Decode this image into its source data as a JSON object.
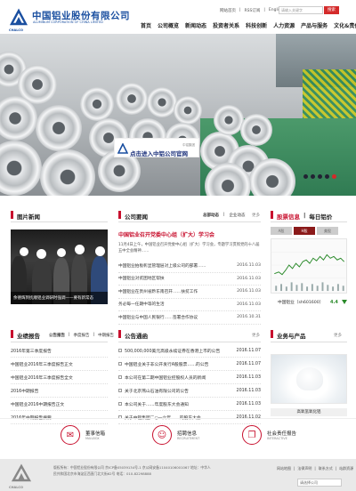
{
  "header": {
    "logo_cn": "中国铝业股份有限公司",
    "logo_en": "ALUMINUM CORPORATION OF CHINA LIMITED",
    "logo_sub": "CHALCO",
    "toplinks": [
      "网站首页",
      "RSS订阅",
      "English"
    ],
    "search_placeholder": "请输入关键字",
    "search_button": "搜索"
  },
  "nav": [
    "首页",
    "公司概览",
    "新闻动态",
    "投资者关系",
    "科技创新",
    "人力资源",
    "产品与服务",
    "文化&责任"
  ],
  "banner": {
    "overlay_text": "点击进入中铝公司官网",
    "overlay_small": "中铝集团"
  },
  "image_news": {
    "title": "图片新闻",
    "caption": "余德辉到抚顺铝业调研时强调——要有新常态"
  },
  "company_news": {
    "title": "公司要闻",
    "tabs": [
      "总部动态",
      "企业动态"
    ],
    "more": "更多",
    "headline": "中国铝业召开党委中心组（扩大）学习会",
    "summary": "11月4日上午，中国铝业召开党委中心组（扩大）学习会，专题学习贯彻党的十八届五中全会精神……",
    "items": [
      {
        "title": "中国铝业拍板彰显管理层对上级公司的部署……",
        "date": "2016.11.03"
      },
      {
        "title": "中国铝业对贫困地区帮扶",
        "date": "2016.11.03"
      },
      {
        "title": "中国铝业在贵州省黔东南召开……扶贫工作",
        "date": "2016.11.03"
      },
      {
        "title": "务必每一任期中等的生活",
        "date": "2016.11.03"
      },
      {
        "title": "中国铝业与中国人民银行……签署合作协议",
        "date": "2016.10.31"
      }
    ]
  },
  "stock": {
    "tab1": "股票信息",
    "tab2": "每日铝价",
    "tabs": [
      "A股",
      "H股",
      "美股"
    ],
    "label": "中国铝业（sh601600）",
    "value": "4.4"
  },
  "reports": {
    "title": "业绩报告",
    "tabs": [
      "公告报告",
      "季度报告",
      "中期报告"
    ],
    "more": "更多",
    "items": [
      "2016年第三季度报告",
      "中国铝业2016年三季度报告正文",
      "中国铝业2016年三季度报告全文",
      "2016中期报告",
      "中国铝业2016中期报告正文",
      "2016年中期报告摘要"
    ]
  },
  "announcements": {
    "title": "公告通函",
    "more": "更多",
    "items": [
      {
        "title": "500,000,000美元高级永续证券在香港上市的公告",
        "date": "2016.11.07"
      },
      {
        "title": "中国铝业关于非公开发行A股股票……的公告",
        "date": "2016.11.07"
      },
      {
        "title": "本公司在第二期中国铝业控股权人员的新闻",
        "date": "2016.11.03"
      },
      {
        "title": "关于北京燕山石油有限公司的公告",
        "date": "2016.11.03"
      },
      {
        "title": "本公司关于……年度股东大会通知",
        "date": "2016.11.03"
      },
      {
        "title": "关于中铝集团二○一六年……的股东大会",
        "date": "2016.11.02"
      }
    ]
  },
  "products": {
    "title": "业务与产品",
    "more": "更多",
    "caption": "高氧氢氧化铝"
  },
  "quick_links": [
    {
      "cn": "董事信箱",
      "en": "MAILBOX",
      "icon": "mail-icon"
    },
    {
      "cn": "招聘信息",
      "en": "RECRUITMENT",
      "icon": "recruit-icon"
    },
    {
      "cn": "社会责任报告",
      "en": "INTERACTIVE",
      "icon": "report-icon"
    }
  ],
  "footer": {
    "text": "版权所有：中国铝业股份有限公司  京ICP备05039134号-1  京公网安备11040106001067  地址：中华人民共和国北京市海淀区西直门北大街62号  电话：010-82298888",
    "links": [
      "网站地图",
      "法律声明",
      "联系方式",
      "站群资源"
    ],
    "select": "请选择公司"
  },
  "colors": {
    "accent": "#c8102e",
    "brand": "#1a4fa0"
  }
}
